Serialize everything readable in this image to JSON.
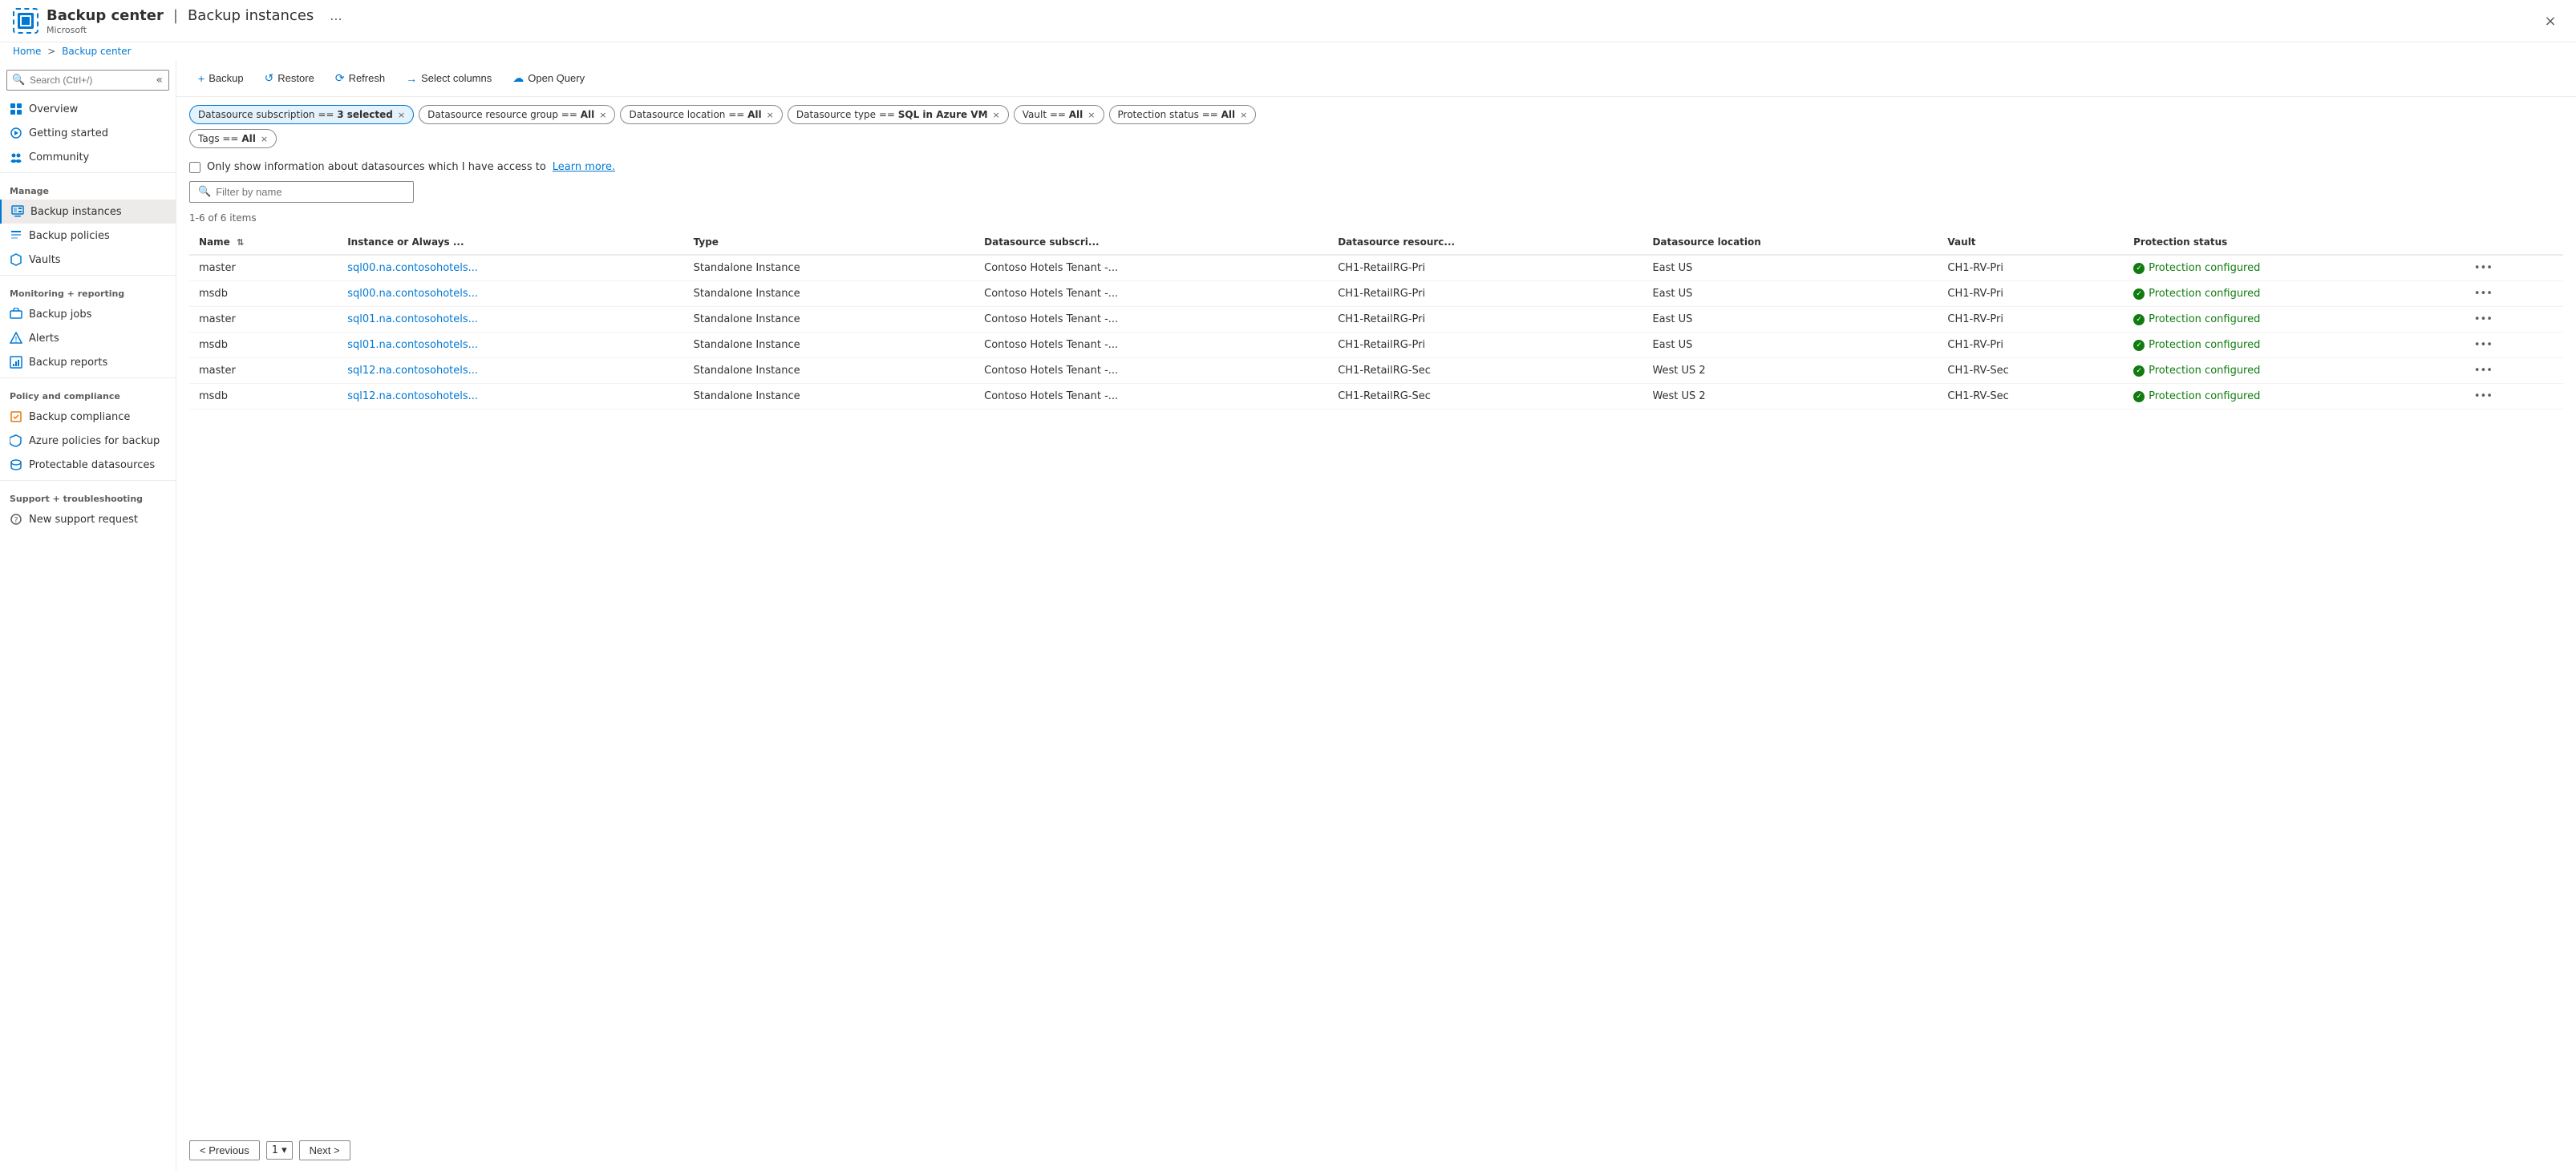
{
  "app": {
    "title": "Backup center",
    "separator": "|",
    "subtitle": "Backup instances",
    "vendor": "Microsoft",
    "ellipsis": "...",
    "close_label": "×"
  },
  "breadcrumb": {
    "home": "Home",
    "separator": ">",
    "current": "Backup center"
  },
  "sidebar": {
    "search_placeholder": "Search (Ctrl+/)",
    "collapse_hint": "«",
    "nav_items": [
      {
        "id": "overview",
        "label": "Overview",
        "icon": "overview"
      },
      {
        "id": "getting-started",
        "label": "Getting started",
        "icon": "getting-started"
      },
      {
        "id": "community",
        "label": "Community",
        "icon": "community"
      }
    ],
    "sections": [
      {
        "label": "Manage",
        "items": [
          {
            "id": "backup-instances",
            "label": "Backup instances",
            "icon": "backup-instances",
            "active": true
          },
          {
            "id": "backup-policies",
            "label": "Backup policies",
            "icon": "backup-policies"
          },
          {
            "id": "vaults",
            "label": "Vaults",
            "icon": "vaults"
          }
        ]
      },
      {
        "label": "Monitoring + reporting",
        "items": [
          {
            "id": "backup-jobs",
            "label": "Backup jobs",
            "icon": "backup-jobs"
          },
          {
            "id": "alerts",
            "label": "Alerts",
            "icon": "alerts"
          },
          {
            "id": "backup-reports",
            "label": "Backup reports",
            "icon": "backup-reports"
          }
        ]
      },
      {
        "label": "Policy and compliance",
        "items": [
          {
            "id": "backup-compliance",
            "label": "Backup compliance",
            "icon": "backup-compliance"
          },
          {
            "id": "azure-policies",
            "label": "Azure policies for backup",
            "icon": "azure-policies"
          },
          {
            "id": "protectable-datasources",
            "label": "Protectable datasources",
            "icon": "protectable-datasources"
          }
        ]
      },
      {
        "label": "Support + troubleshooting",
        "items": [
          {
            "id": "new-support-request",
            "label": "New support request",
            "icon": "new-support-request"
          }
        ]
      }
    ]
  },
  "toolbar": {
    "backup_label": "+ Backup",
    "restore_label": "Restore",
    "refresh_label": "Refresh",
    "select_columns_label": "Select columns",
    "open_query_label": "Open Query"
  },
  "filters": [
    {
      "id": "datasource-subscription",
      "label": "Datasource subscription == ",
      "value": "3 selected",
      "active": true
    },
    {
      "id": "datasource-resource-group",
      "label": "Datasource resource group == ",
      "value": "All",
      "active": false
    },
    {
      "id": "datasource-location",
      "label": "Datasource location == ",
      "value": "All",
      "active": false
    },
    {
      "id": "datasource-type",
      "label": "Datasource type == ",
      "value": "SQL in Azure VM",
      "active": false
    },
    {
      "id": "vault",
      "label": "Vault == ",
      "value": "All",
      "active": false
    },
    {
      "id": "protection-status",
      "label": "Protection status == ",
      "value": "All",
      "active": false
    },
    {
      "id": "tags",
      "label": "Tags == ",
      "value": "All",
      "active": false
    }
  ],
  "checkbox": {
    "label": "Only show information about datasources which I have access to",
    "link_text": "Learn more."
  },
  "search": {
    "placeholder": "Filter by name"
  },
  "count": {
    "text": "1-6 of 6 items"
  },
  "table": {
    "columns": [
      {
        "id": "name",
        "label": "Name",
        "sortable": true
      },
      {
        "id": "instance",
        "label": "Instance or Always ...",
        "sortable": false
      },
      {
        "id": "type",
        "label": "Type",
        "sortable": false
      },
      {
        "id": "datasource-subscription",
        "label": "Datasource subscri...",
        "sortable": false
      },
      {
        "id": "datasource-resource",
        "label": "Datasource resourc...",
        "sortable": false
      },
      {
        "id": "datasource-location",
        "label": "Datasource location",
        "sortable": false
      },
      {
        "id": "vault",
        "label": "Vault",
        "sortable": false
      },
      {
        "id": "protection-status",
        "label": "Protection status",
        "sortable": false
      }
    ],
    "rows": [
      {
        "name": "master",
        "instance": "sql00.na.contosohotels...",
        "instance_href": "#",
        "type": "Standalone Instance",
        "datasource_subscription": "Contoso Hotels Tenant -...",
        "datasource_resource": "CH1-RetailRG-Pri",
        "datasource_location": "East US",
        "vault": "CH1-RV-Pri",
        "protection_status": "Protection configured"
      },
      {
        "name": "msdb",
        "instance": "sql00.na.contosohotels...",
        "instance_href": "#",
        "type": "Standalone Instance",
        "datasource_subscription": "Contoso Hotels Tenant -...",
        "datasource_resource": "CH1-RetailRG-Pri",
        "datasource_location": "East US",
        "vault": "CH1-RV-Pri",
        "protection_status": "Protection configured"
      },
      {
        "name": "master",
        "instance": "sql01.na.contosohotels...",
        "instance_href": "#",
        "type": "Standalone Instance",
        "datasource_subscription": "Contoso Hotels Tenant -...",
        "datasource_resource": "CH1-RetailRG-Pri",
        "datasource_location": "East US",
        "vault": "CH1-RV-Pri",
        "protection_status": "Protection configured"
      },
      {
        "name": "msdb",
        "instance": "sql01.na.contosohotels...",
        "instance_href": "#",
        "type": "Standalone Instance",
        "datasource_subscription": "Contoso Hotels Tenant -...",
        "datasource_resource": "CH1-RetailRG-Pri",
        "datasource_location": "East US",
        "vault": "CH1-RV-Pri",
        "protection_status": "Protection configured"
      },
      {
        "name": "master",
        "instance": "sql12.na.contosohotels...",
        "instance_href": "#",
        "type": "Standalone Instance",
        "datasource_subscription": "Contoso Hotels Tenant -...",
        "datasource_resource": "CH1-RetailRG-Sec",
        "datasource_location": "West US 2",
        "vault": "CH1-RV-Sec",
        "protection_status": "Protection configured"
      },
      {
        "name": "msdb",
        "instance": "sql12.na.contosohotels...",
        "instance_href": "#",
        "type": "Standalone Instance",
        "datasource_subscription": "Contoso Hotels Tenant -...",
        "datasource_resource": "CH1-RetailRG-Sec",
        "datasource_location": "West US 2",
        "vault": "CH1-RV-Sec",
        "protection_status": "Protection configured"
      }
    ]
  },
  "pagination": {
    "previous_label": "< Previous",
    "next_label": "Next >",
    "current_page": "1"
  }
}
